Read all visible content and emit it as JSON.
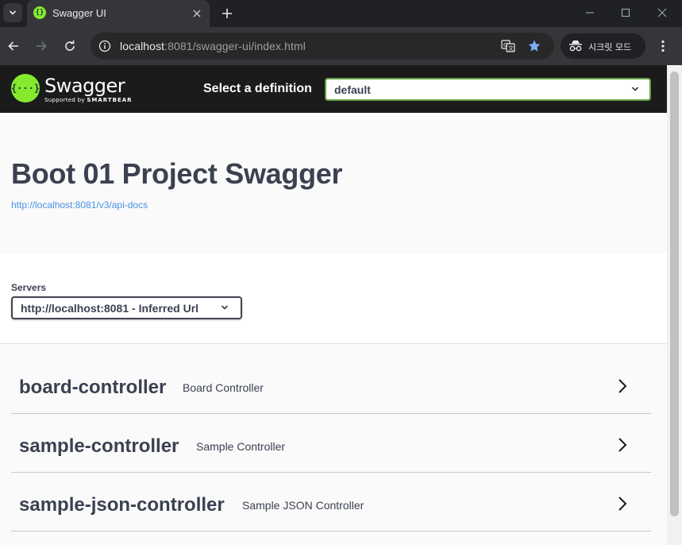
{
  "browser": {
    "tab_title": "Swagger UI",
    "url_host": "localhost",
    "url_rest": ":8081/swagger-ui/index.html",
    "incognito_label": "시크릿 모드"
  },
  "topbar": {
    "logo_text": "Swagger",
    "logo_sub_prefix": "Supported by",
    "logo_sub_brand": "SMARTBEAR",
    "definition_label": "Select a definition",
    "definition_value": "default"
  },
  "info": {
    "title": "Boot 01 Project Swagger",
    "spec_link": "http://localhost:8081/v3/api-docs"
  },
  "servers": {
    "label": "Servers",
    "selected": "http://localhost:8081 - Inferred Url"
  },
  "tags": [
    {
      "name": "board-controller",
      "description": "Board Controller"
    },
    {
      "name": "sample-controller",
      "description": "Sample Controller"
    },
    {
      "name": "sample-json-controller",
      "description": "Sample JSON Controller"
    }
  ],
  "colors": {
    "swagger_green": "#85ea2d",
    "topbar_bg": "#1b1b1b",
    "text": "#3b4151",
    "link": "#4990e2",
    "select_border": "#62a03f"
  },
  "icons": {
    "tab_list": "chevron-down-icon",
    "close_tab": "close-icon",
    "new_tab": "plus-icon",
    "back": "arrow-left-icon",
    "forward": "arrow-right-icon",
    "reload": "reload-icon",
    "site_info": "info-icon",
    "translate": "translate-icon",
    "bookmark": "star-icon",
    "incognito": "incognito-icon",
    "menu": "kebab-menu-icon",
    "tag_expand": "chevron-right-icon"
  }
}
